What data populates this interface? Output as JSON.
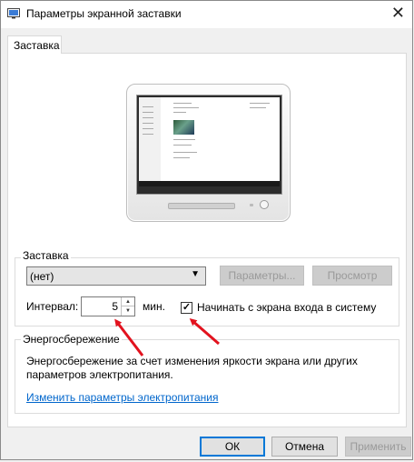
{
  "window": {
    "title": "Параметры экранной заставки"
  },
  "tabs": [
    {
      "label": "Заставка"
    }
  ],
  "screensaver": {
    "legend": "Заставка",
    "selected": "(нет)",
    "settings_button": "Параметры...",
    "preview_button": "Просмотр"
  },
  "interval": {
    "label": "Интервал:",
    "value": "5",
    "unit": "мин.",
    "resume_checkbox_label": "Начинать с экрана входа в систему",
    "resume_checked": true
  },
  "power": {
    "legend": "Энергосбережение",
    "description_line1": "Энергосбережение за счет изменения яркости экрана или других",
    "description_line2": "параметров электропитания.",
    "link": "Изменить параметры электропитания"
  },
  "footer": {
    "ok": "ОК",
    "cancel": "Отмена",
    "apply": "Применить"
  },
  "colors": {
    "accent": "#0078d7",
    "arrow": "#e2121e",
    "link": "#0066cc"
  },
  "icons": [
    "screensaver-app-icon",
    "close-icon",
    "chevron-down-icon",
    "spin-up-icon",
    "spin-down-icon",
    "checkmark-icon",
    "arrow-annotation"
  ]
}
